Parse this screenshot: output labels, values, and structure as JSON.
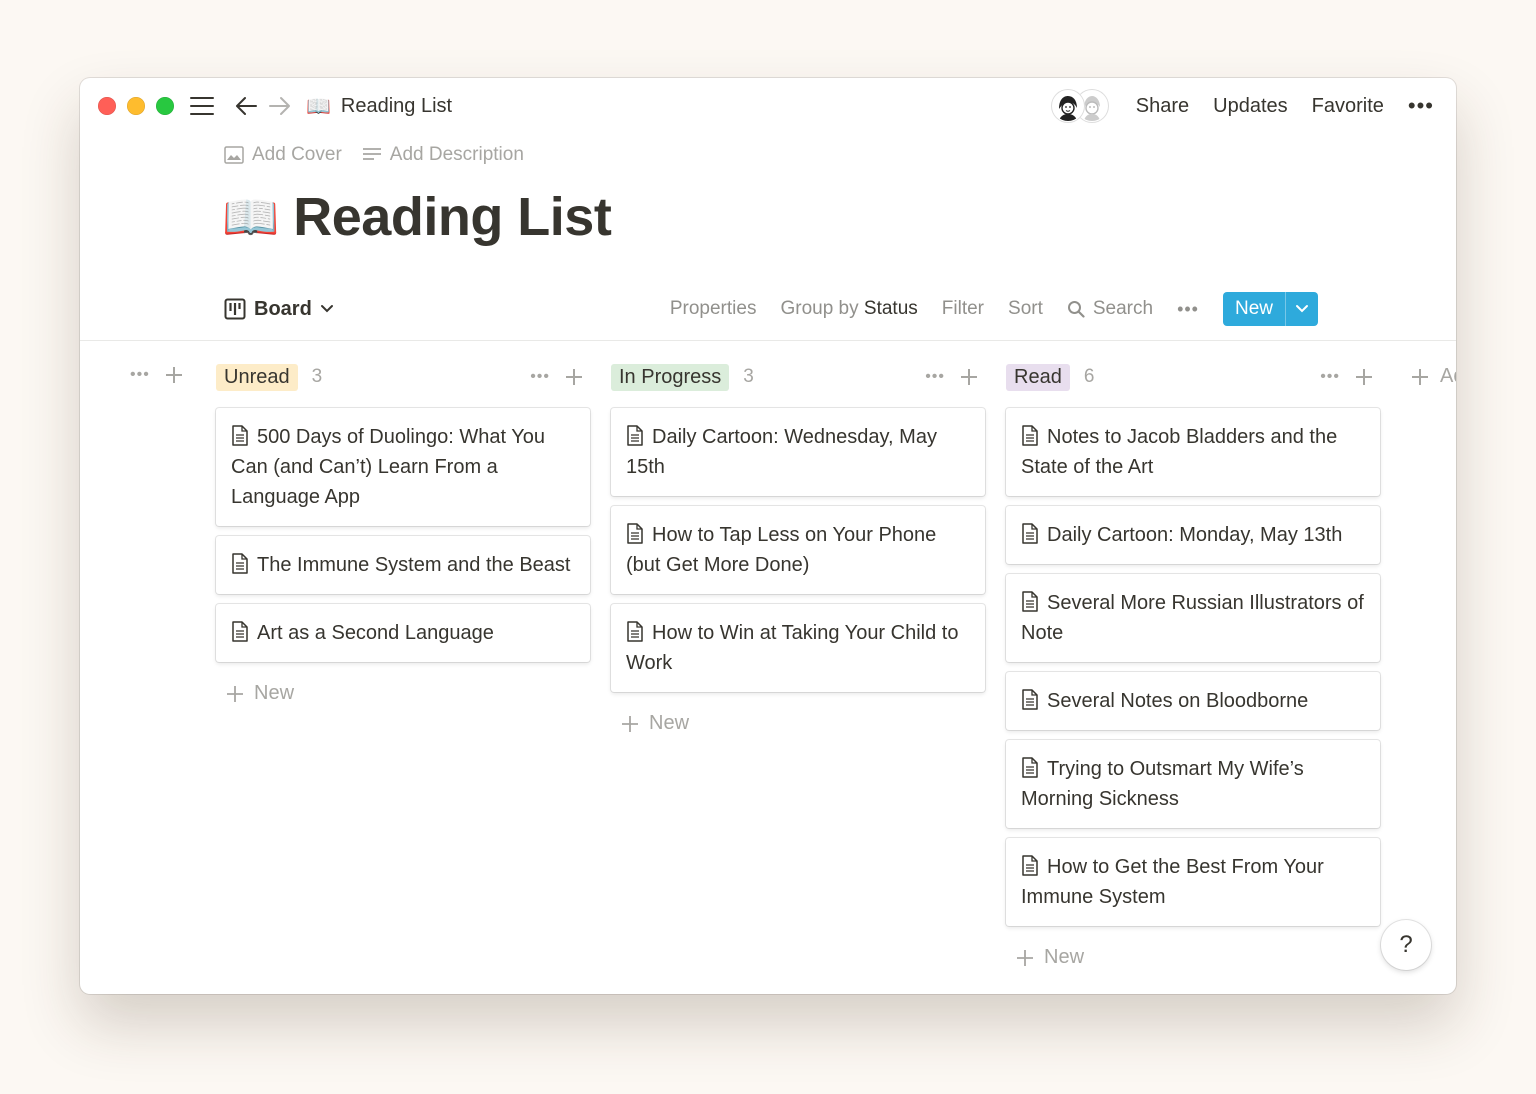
{
  "breadcrumb": {
    "emoji": "📖",
    "title": "Reading List"
  },
  "topbar": {
    "share": "Share",
    "updates": "Updates",
    "favorite": "Favorite",
    "more": "•••"
  },
  "page": {
    "add_cover": "Add Cover",
    "add_description": "Add Description",
    "emoji": "📖",
    "title": "Reading List"
  },
  "view": {
    "name": "Board",
    "properties": "Properties",
    "group_by_prefix": "Group by",
    "group_by_value": "Status",
    "filter": "Filter",
    "sort": "Sort",
    "search": "Search",
    "more": "•••",
    "new": "New"
  },
  "board": {
    "new_label": "New",
    "add_group": "Add a group",
    "columns": [
      {
        "tag": "Unread",
        "count": "3",
        "color": "#fdecc8",
        "cards": [
          "500 Days of Duolingo: What You Can (and Can’t) Learn From a Language App",
          "The Immune System and the Beast",
          "Art as a Second Language"
        ]
      },
      {
        "tag": "In Progress",
        "count": "3",
        "color": "#dbeddb",
        "cards": [
          "Daily Cartoon: Wednesday, May 15th",
          "How to Tap Less on Your Phone (but Get More Done)",
          "How to Win at Taking Your Child to Work"
        ]
      },
      {
        "tag": "Read",
        "count": "6",
        "color": "#e8deee",
        "cards": [
          "Notes to Jacob Bladders and the State of the Art",
          "Daily Cartoon: Monday, May 13th",
          "Several More Russian Illustrators of Note",
          "Several Notes on Bloodborne",
          "Trying to Outsmart My Wife’s Morning Sickness",
          "How to Get the Best From Your Immune System"
        ]
      }
    ]
  },
  "help": "?"
}
